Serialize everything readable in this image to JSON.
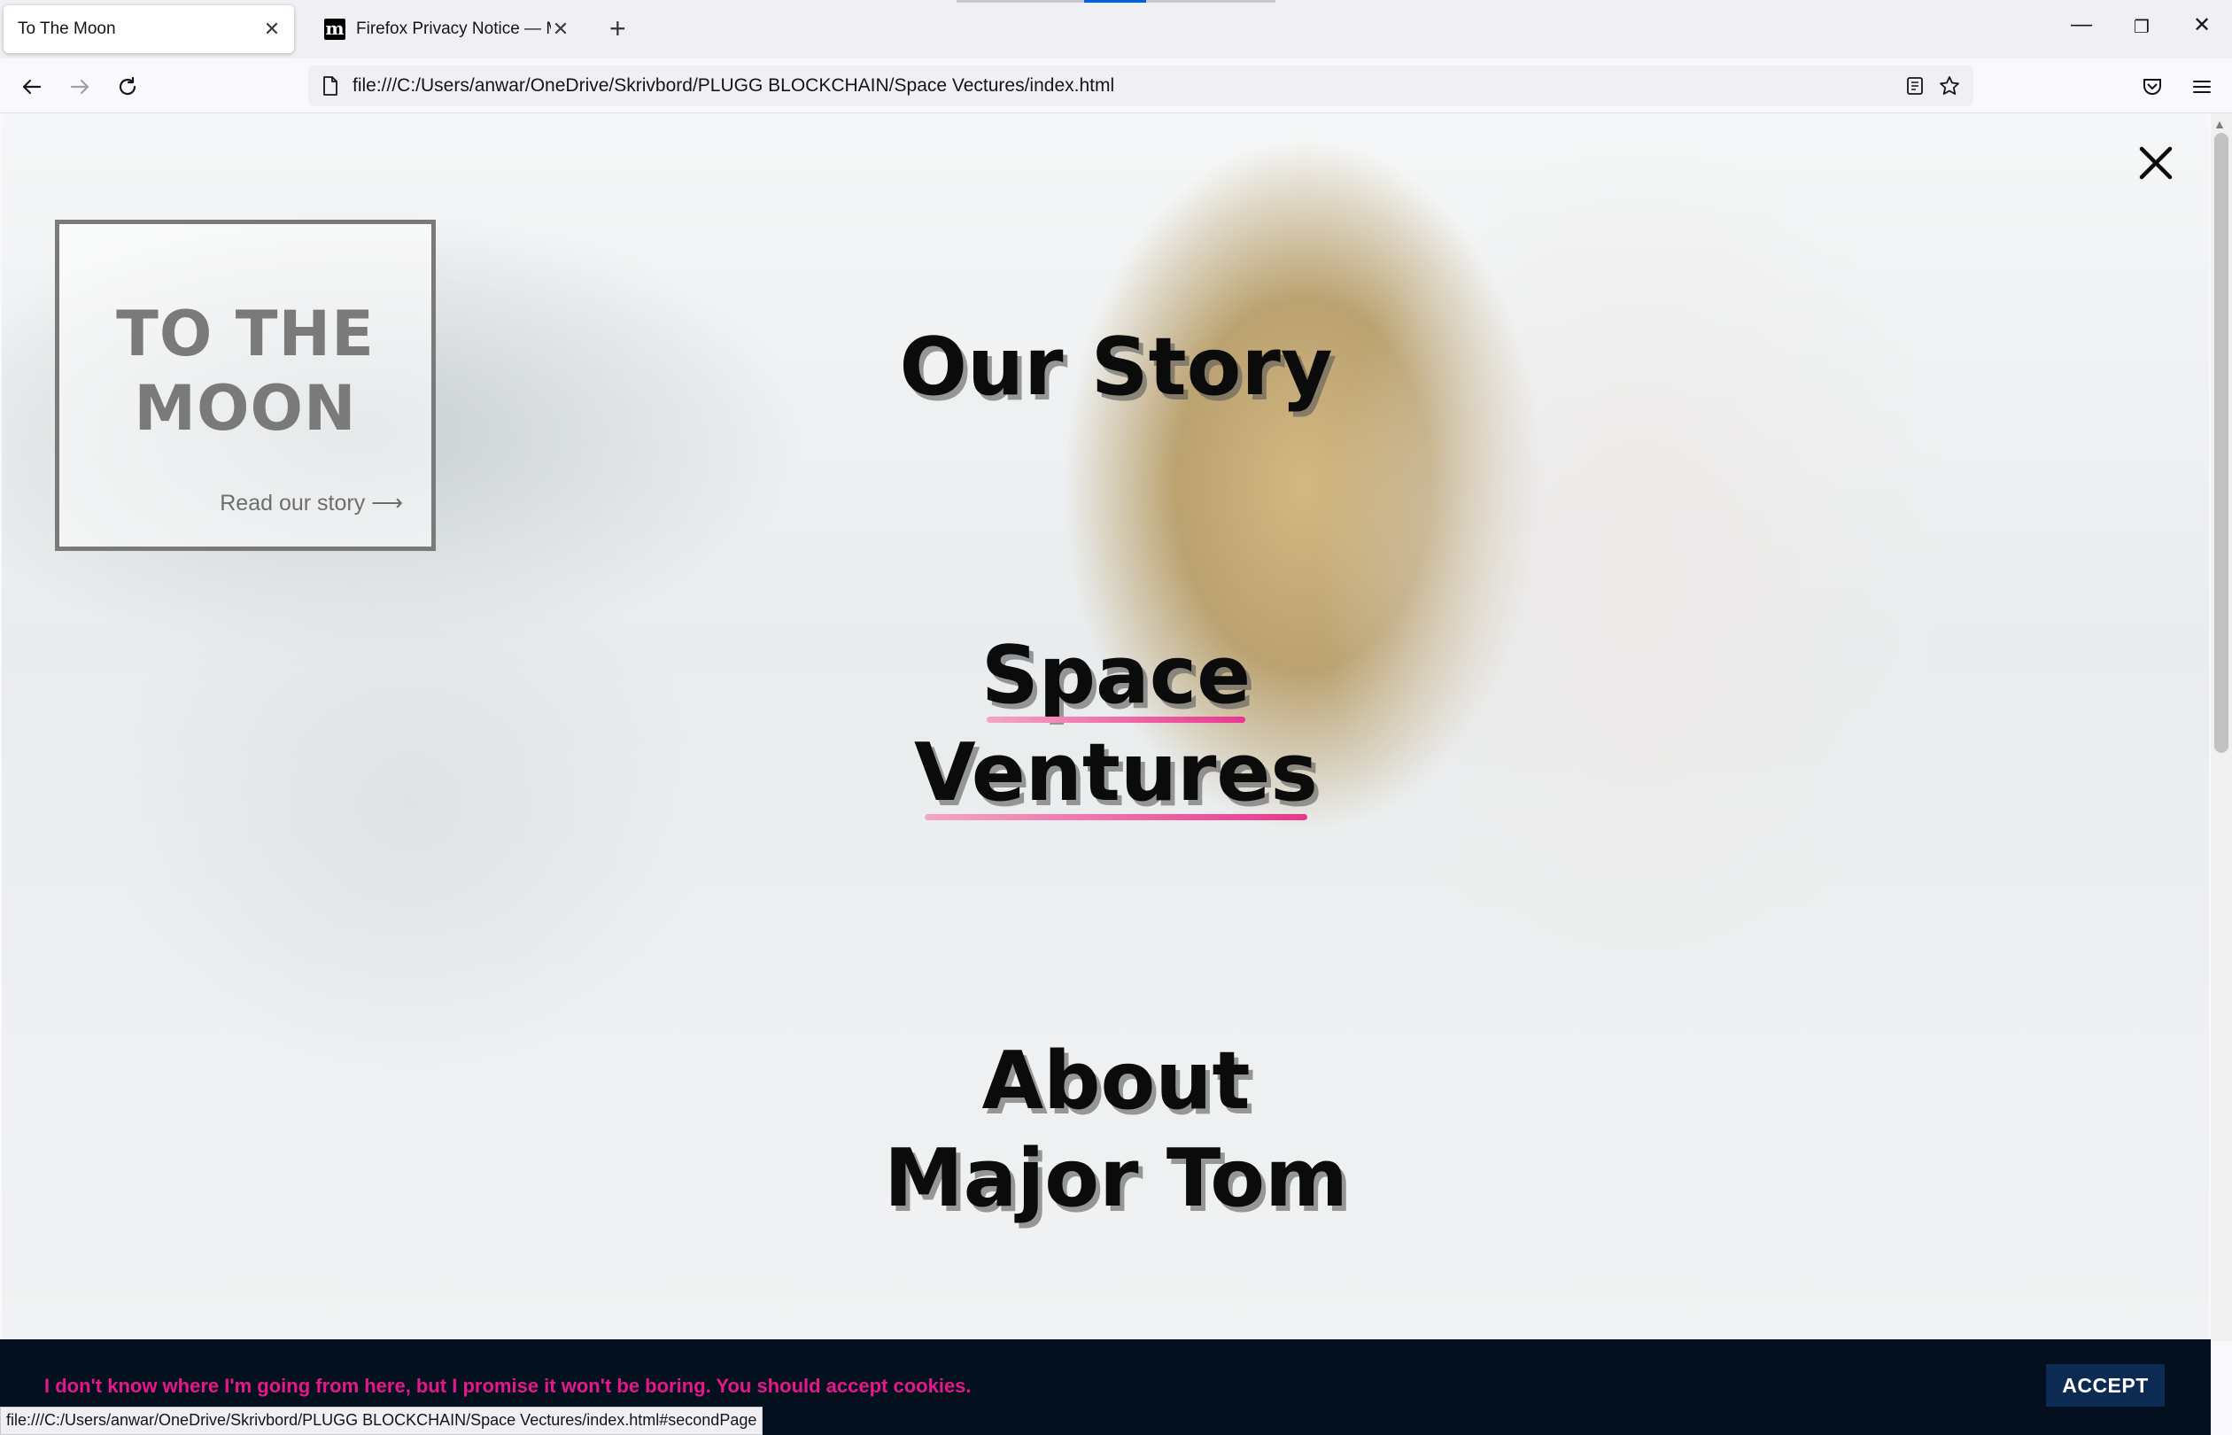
{
  "browser": {
    "tabs": [
      {
        "title": "To The Moon",
        "active": true
      },
      {
        "title": "Firefox Privacy Notice — Mozilla",
        "favicon": "m",
        "active": false
      }
    ],
    "url": "file:///C:/Users/anwar/OneDrive/Skrivbord/PLUGG BLOCKCHAIN/Space Vectures/index.html",
    "status_url": "file:///C:/Users/anwar/OneDrive/Skrivbord/PLUGG BLOCKCHAIN/Space Vectures/index.html#secondPage"
  },
  "logo": {
    "title_line1": "TO THE",
    "title_line2": "MOON",
    "link": "Read our story ⟶"
  },
  "menu": {
    "our_story": "Our Story",
    "space_ventures_line1": "Space",
    "space_ventures_line2": "Ventures",
    "about_line1": "About",
    "about_line2": "Major Tom"
  },
  "cookie": {
    "message": "I don't know where I'm going from here, but I promise it won't be boring. You should accept cookies.",
    "accept_label": "ACCEPT"
  },
  "colors": {
    "accent_pink": "#e8368f",
    "cookie_bg": "#05101f",
    "accept_bg": "#0c2a52"
  }
}
